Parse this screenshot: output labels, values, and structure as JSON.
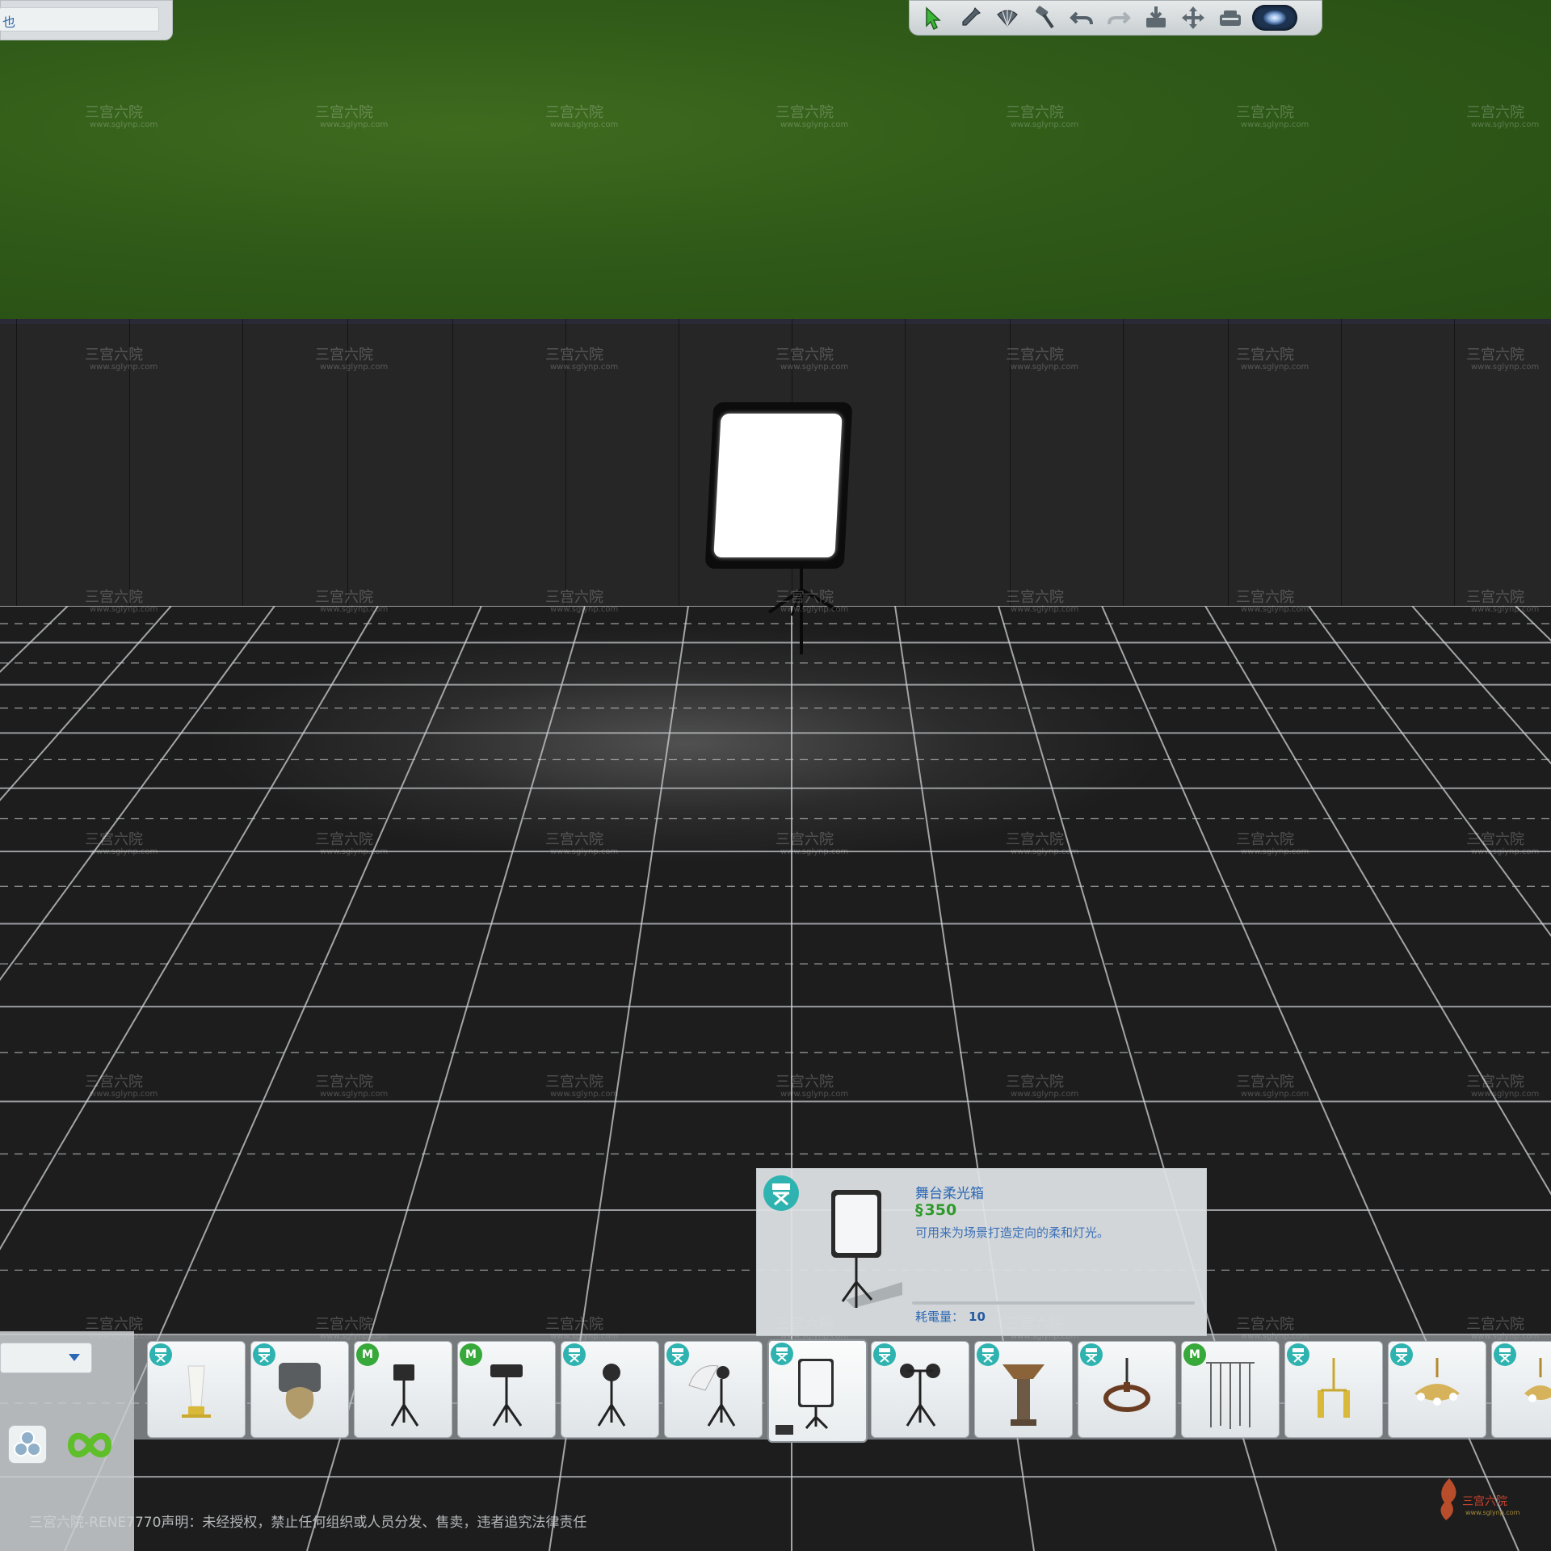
{
  "top_left_panel": {
    "text": "也"
  },
  "toolbar": {
    "buttons": [
      {
        "icon": "select-arrow-icon"
      },
      {
        "icon": "eyedropper-icon"
      },
      {
        "icon": "design-tool-fan-icon"
      },
      {
        "icon": "sledgehammer-icon"
      },
      {
        "icon": "undo-icon"
      },
      {
        "icon": "redo-icon"
      },
      {
        "icon": "save-to-library-icon"
      },
      {
        "icon": "move-arrows-icon"
      },
      {
        "icon": "camera-view-icon"
      },
      {
        "icon": "eye-view-icon"
      }
    ]
  },
  "info_panel": {
    "name": "舞台柔光箱",
    "price_symbol": "§",
    "price": "350",
    "description": "可用来为场景打造定向的柔和灯光。",
    "power_label": "耗電量：",
    "power_value": "10"
  },
  "catalog": {
    "items": [
      {
        "badge": "director-chair",
        "object": "floor-lamp-white"
      },
      {
        "badge": "director-chair",
        "object": "table-lamp-drum"
      },
      {
        "badge": "M",
        "object": "led-panel-stand"
      },
      {
        "badge": "M",
        "object": "barn-door-light-stand"
      },
      {
        "badge": "director-chair",
        "object": "spotlight-stand"
      },
      {
        "badge": "director-chair",
        "object": "umbrella-light-stand"
      },
      {
        "badge": "director-chair",
        "object": "softbox-stand",
        "selected": true
      },
      {
        "badge": "director-chair",
        "object": "twin-spotlight-stand"
      },
      {
        "badge": "director-chair",
        "object": "pedestal-torch-lamp"
      },
      {
        "badge": "director-chair",
        "object": "chandelier-candle-ring"
      },
      {
        "badge": "M",
        "object": "hanging-pipes-light"
      },
      {
        "badge": "director-chair",
        "object": "gold-sconce-pair"
      },
      {
        "badge": "director-chair",
        "object": "crystal-chandelier"
      },
      {
        "badge": "director-chair",
        "object": "gold-chandelier-partial"
      }
    ]
  },
  "watermark": {
    "line1": "三宫六院",
    "line2": "www.sglynp.com"
  },
  "footer": {
    "text": "三宮六院-RENE7770声明：未经授权，禁止任何组织或人员分发、售卖，违者追究法律责任"
  },
  "corner_logo": {
    "text": "三宫六院",
    "url": "www.sglynp.com"
  },
  "colors": {
    "lawn": "#2f5a18",
    "wall": "#262626",
    "floor": "#1d1d1d",
    "accent_blue": "#2a67b5",
    "price_green": "#2e9a2a",
    "badge_teal": "#2fb3b0",
    "badge_green": "#37a83a"
  }
}
